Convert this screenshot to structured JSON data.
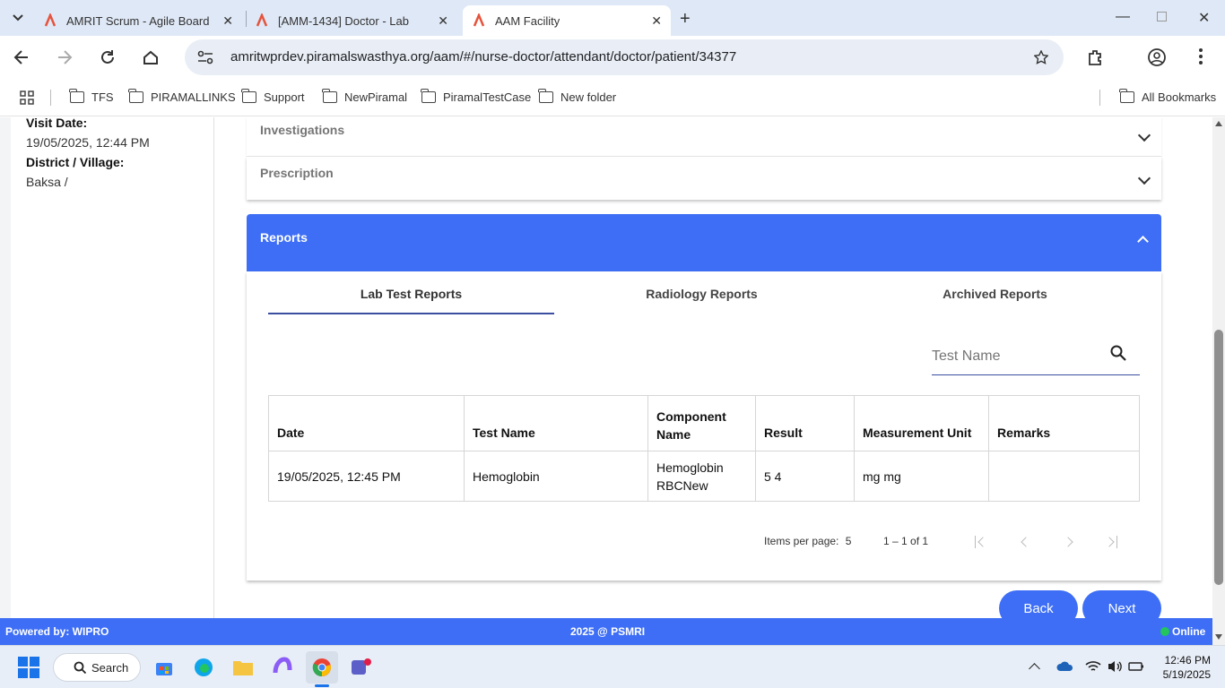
{
  "browser": {
    "tabs": [
      {
        "title": "AMRIT Scrum - Agile Board"
      },
      {
        "title": "[AMM-1434] Doctor - Lab R"
      },
      {
        "title": "AAM Facility"
      }
    ],
    "url": "amritwprdev.piramalswasthya.org/aam/#/nurse-doctor/attendant/doctor/patient/34377",
    "bookmarks": [
      "TFS",
      "PIRAMALLINKS",
      "Support",
      "NewPiramal",
      "PiramalTestCase",
      "New folder"
    ],
    "all_bookmarks": "All Bookmarks"
  },
  "sidebar": {
    "visit_date_label": "Visit Date:",
    "visit_date": "19/05/2025, 12:44 PM",
    "district_label": "District / Village:",
    "district": "Baksa /"
  },
  "sections": {
    "investigations": "Investigations",
    "prescription": "Prescription",
    "reports": "Reports"
  },
  "report_tabs": [
    "Lab Test Reports",
    "Radiology Reports",
    "Archived Reports"
  ],
  "search": {
    "placeholder": "Test Name"
  },
  "table": {
    "headers": [
      "Date",
      "Test Name",
      "Component Name",
      "Result",
      "Measurement Unit",
      "Remarks"
    ],
    "rows": [
      {
        "date": "19/05/2025, 12:45 PM",
        "test": "Hemoglobin",
        "component_1": "Hemoglobin",
        "component_2": "RBCNew",
        "result": "5 4",
        "unit": "mg mg",
        "remarks": ""
      }
    ]
  },
  "paginator": {
    "items_per_page_label": "Items per page:",
    "items_per_page": "5",
    "range": "1 – 1 of 1"
  },
  "buttons": {
    "back": "Back",
    "next": "Next"
  },
  "footer": {
    "left": "Powered by: WIPRO",
    "center": "2025 @ PSMRI",
    "status": "Online"
  },
  "taskbar": {
    "search": "Search",
    "time": "12:46 PM",
    "date": "5/19/2025"
  },
  "colors": {
    "primary": "#3d6ef5",
    "online": "#22c55e"
  }
}
